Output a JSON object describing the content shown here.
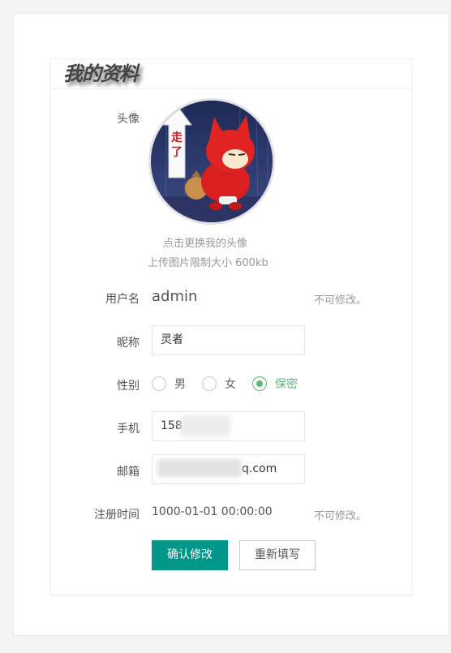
{
  "page": {
    "title": "我的资料"
  },
  "avatar": {
    "label": "头像",
    "change_hint": "点击更换我的头像",
    "size_hint": "上传图片限制大小 600kb",
    "sign_text": "走了"
  },
  "form": {
    "username": {
      "label": "用户名",
      "value": "admin",
      "note": "不可修改。"
    },
    "nickname": {
      "label": "昵称",
      "value": "灵者"
    },
    "gender": {
      "label": "性别",
      "options": [
        "男",
        "女",
        "保密"
      ],
      "selected": "保密"
    },
    "phone": {
      "label": "手机",
      "value": "158"
    },
    "email": {
      "label": "邮箱",
      "value": "q.com"
    },
    "register_time": {
      "label": "注册时间",
      "value": "1000-01-01 00:00:00",
      "note": "不可修改。"
    }
  },
  "buttons": {
    "confirm": "确认修改",
    "reset": "重新填写"
  },
  "colors": {
    "primary": "#009688",
    "radio_checked": "#5fb878",
    "avatar_bg": "#2a3766"
  }
}
